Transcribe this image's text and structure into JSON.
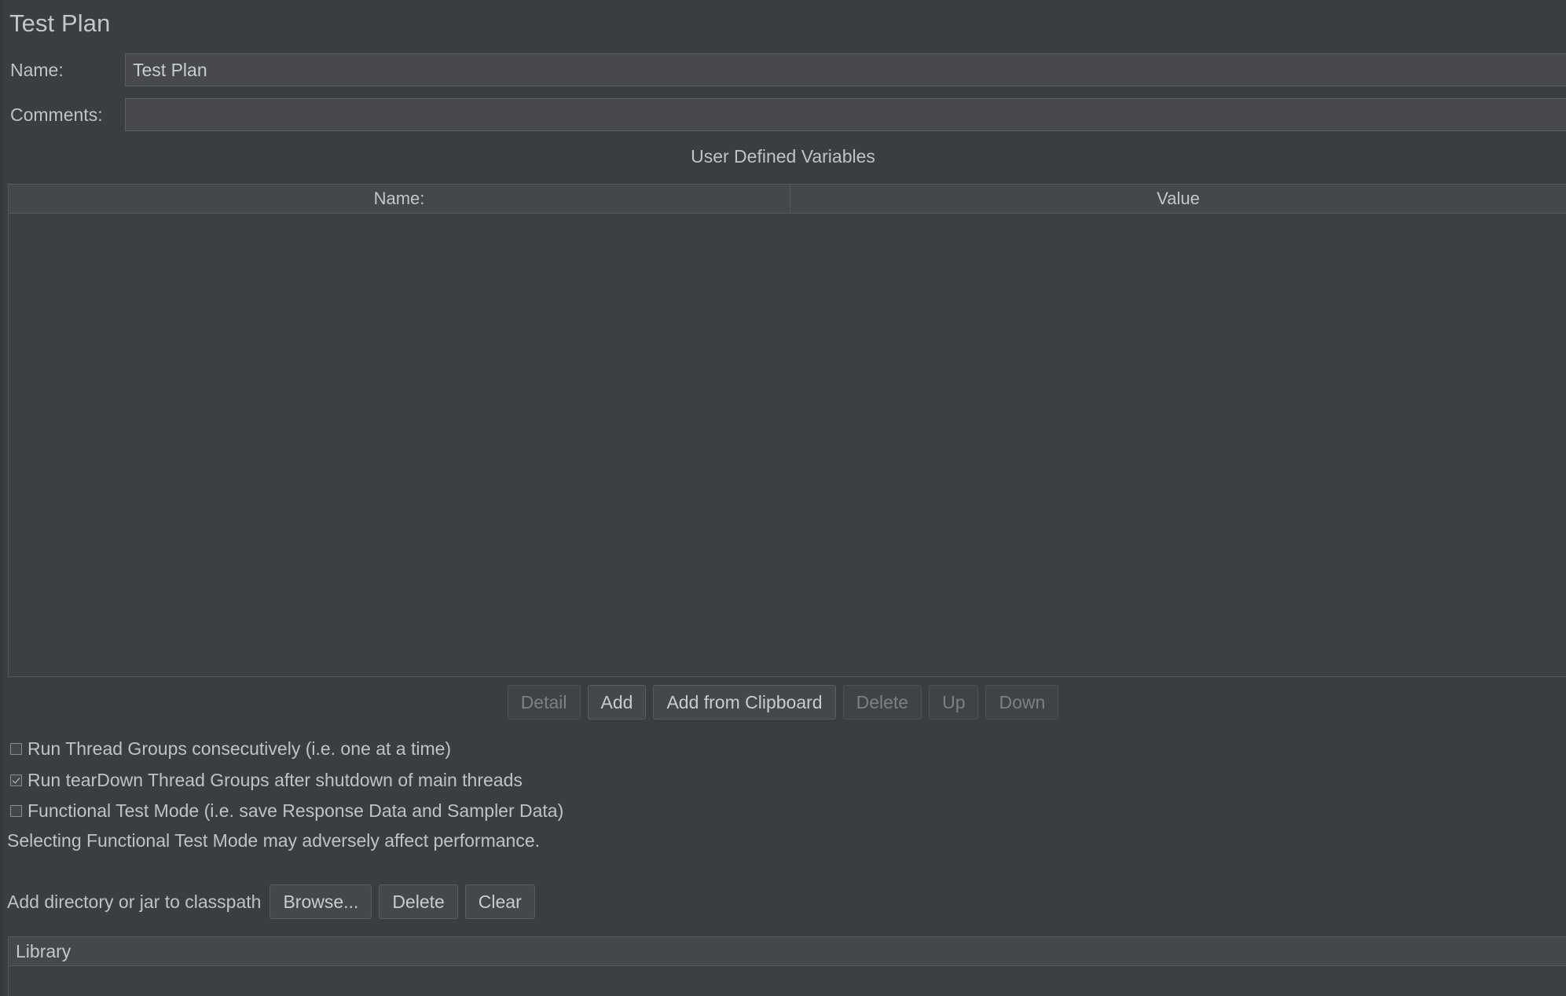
{
  "panel": {
    "title": "Test Plan"
  },
  "fields": {
    "name": {
      "label": "Name:",
      "value": "Test Plan",
      "placeholder": ""
    },
    "comments": {
      "label": "Comments:",
      "value": "",
      "placeholder": ""
    }
  },
  "user_defined_variables": {
    "caption": "User Defined Variables",
    "columns": [
      "Name:",
      "Value"
    ],
    "rows": []
  },
  "variable_buttons": [
    {
      "label": "Detail",
      "enabled": false
    },
    {
      "label": "Add",
      "enabled": true
    },
    {
      "label": "Add from Clipboard",
      "enabled": true
    },
    {
      "label": "Delete",
      "enabled": false
    },
    {
      "label": "Up",
      "enabled": false
    },
    {
      "label": "Down",
      "enabled": false
    }
  ],
  "options": [
    {
      "label": "Run Thread Groups consecutively (i.e. one at a time)",
      "checked": false
    },
    {
      "label": "Run tearDown Thread Groups after shutdown of main threads",
      "checked": true
    },
    {
      "label": "Functional Test Mode (i.e. save Response Data and Sampler Data)",
      "checked": false
    }
  ],
  "note": "Selecting Functional Test Mode may adversely affect performance.",
  "classpath": {
    "label": "Add directory or jar to classpath",
    "buttons": [
      {
        "label": "Browse...",
        "enabled": true
      },
      {
        "label": "Delete",
        "enabled": true
      },
      {
        "label": "Clear",
        "enabled": true
      }
    ]
  },
  "library_table": {
    "columns": [
      "Library"
    ],
    "rows": []
  },
  "colors": {
    "panel_background": "#3a3e42",
    "field_background": "#47494d",
    "table_background": "#3c4044",
    "table_header_background": "#44484c",
    "border": "#55585c",
    "text": "#bfc2c6",
    "text_disabled": "#7c8085"
  }
}
